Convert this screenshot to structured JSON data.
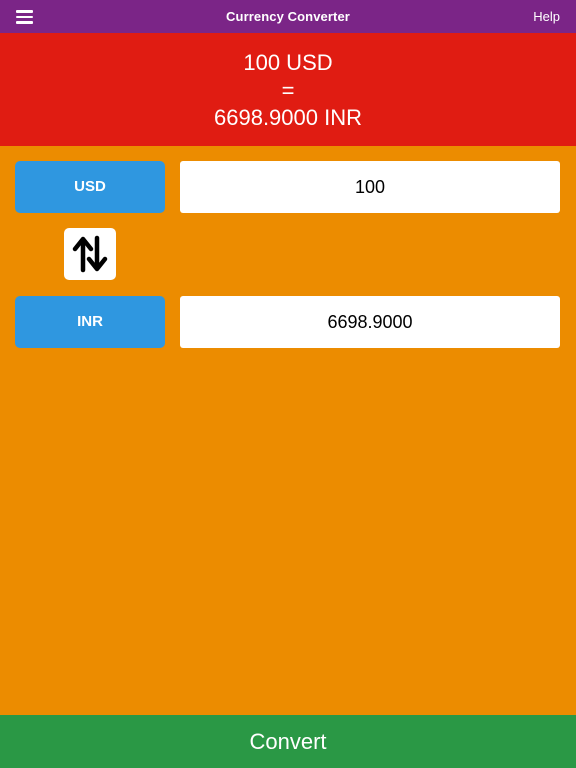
{
  "navbar": {
    "title": "Currency Converter",
    "help_label": "Help",
    "menu_icon": "hamburger-menu-icon"
  },
  "result": {
    "from_text": "100 USD",
    "equals_text": "=",
    "to_text": "6698.9000 INR"
  },
  "from_currency": {
    "code": "USD",
    "amount": "100"
  },
  "swap": {
    "icon": "swap-vertical-arrows-icon"
  },
  "to_currency": {
    "code": "INR",
    "amount": "6698.9000"
  },
  "actions": {
    "convert_label": "Convert"
  },
  "colors": {
    "navbar": "#7b2587",
    "result_banner": "#e01c12",
    "background": "#ec8c00",
    "currency_button": "#2f97e0",
    "convert_button": "#2a9845"
  }
}
